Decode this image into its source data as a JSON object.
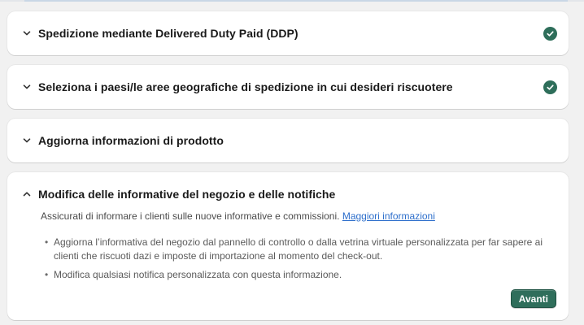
{
  "sections": [
    {
      "title": "Spedizione mediante Delivered Duty Paid (DDP)",
      "state": "collapsed",
      "completed": true,
      "icon": "chevron-down-icon"
    },
    {
      "title": "Seleziona i paesi/le aree geografiche di spedizione in cui desideri riscuotere",
      "state": "collapsed",
      "completed": true,
      "icon": "chevron-down-icon"
    },
    {
      "title": "Aggiorna informazioni di prodotto",
      "state": "collapsed",
      "completed": false,
      "icon": "chevron-down-icon"
    },
    {
      "title": "Modifica delle informative del negozio e delle notifiche",
      "state": "expanded",
      "completed": false,
      "icon": "chevron-up-icon",
      "intro_text": "Assicurati di informare i clienti sulle nuove informative e commissioni.",
      "link_label": "Maggiori informazioni",
      "bullets": [
        "Aggiorna l’informativa del negozio dal pannello di controllo o dalla vetrina virtuale personalizzata per far sapere ai clienti che riscuoti dazi e imposte di importazione al momento del check-out.",
        "Modifica qualsiasi notifica personalizzata con questa informazione."
      ],
      "next_button_label": "Avanti"
    }
  ],
  "colors": {
    "accent_green": "#2f6e5b",
    "check_green": "#2e6e5a",
    "link_blue": "#2c6ecb",
    "page_bg": "#f1f1f1"
  }
}
